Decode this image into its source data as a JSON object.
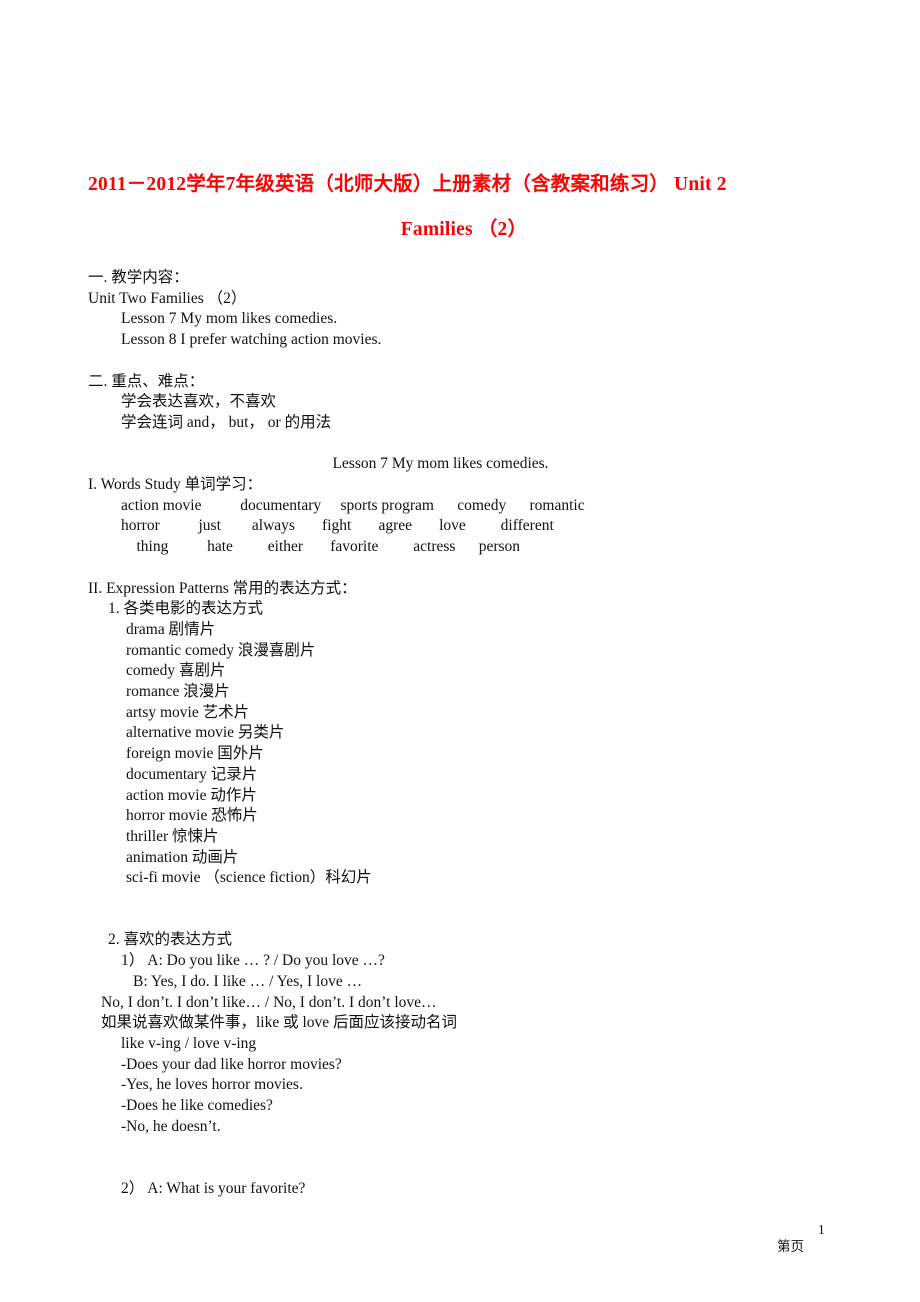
{
  "colors": {
    "title_red": "#ff0000",
    "body_text": "#111111",
    "page_background": "#ffffff"
  },
  "title": {
    "line1": "2011－2012学年7年级英语（北师大版）上册素材（含教案和练习） Unit 2",
    "line2": "Families （2）"
  },
  "section_one": {
    "heading": "一. 教学内容：",
    "unit_line": "Unit Two Families （2）",
    "lessons": [
      "Lesson 7 My mom likes comedies.",
      "Lesson 8 I prefer watching action movies."
    ]
  },
  "section_two": {
    "heading": "二. 重点、难点：",
    "points": [
      "学会表达喜欢，不喜欢",
      "学会连词 and， but， or 的用法"
    ]
  },
  "lesson_seven": {
    "center_heading": "Lesson 7 My mom likes comedies.",
    "words_study": {
      "heading": "I. Words Study 单词学习：",
      "rows": [
        "action movie          documentary     sports program      comedy      romantic",
        "horror          just        always       fight       agree       love         different",
        "    thing          hate         either       favorite         actress      person"
      ],
      "words": [
        "action movie",
        "documentary",
        "sports program",
        "comedy",
        "romantic",
        "horror",
        "just",
        "always",
        "fight",
        "agree",
        "love",
        "different",
        "thing",
        "hate",
        "either",
        "favorite",
        "actress",
        "person"
      ]
    },
    "expression_patterns": {
      "heading": "II. Expression Patterns 常用的表达方式：",
      "sub1": {
        "heading": "1. 各类电影的表达方式",
        "items": [
          "drama 剧情片",
          "romantic comedy 浪漫喜剧片",
          "comedy 喜剧片",
          "romance 浪漫片",
          "artsy movie 艺术片",
          "alternative movie 另类片",
          "foreign movie 国外片",
          "documentary 记录片",
          "action movie 动作片",
          "horror movie 恐怖片",
          "thriller 惊悚片",
          "animation 动画片",
          "sci-fi movie （science fiction）科幻片"
        ]
      },
      "sub2": {
        "heading": "2. 喜欢的表达方式",
        "item1_label": "1） A: Do you like … ? / Do you love …?",
        "item1_b": "B: Yes, I do. I like … / Yes, I love …",
        "negatives": "No, I don’t. I don’t like… / No, I don’t. I don’t love…",
        "note": "如果说喜欢做某件事，like 或 love 后面应该接动名词",
        "pattern": "like v-ing / love v-ing",
        "dialogue": [
          "-Does your dad like horror movies?",
          "-Yes, he loves horror movies.",
          "-Does he like comedies?",
          "-No, he doesn’t."
        ],
        "item2_label": "2） A: What is your favorite?"
      }
    }
  },
  "footer": {
    "page_number": "1",
    "page_label": "第页"
  }
}
